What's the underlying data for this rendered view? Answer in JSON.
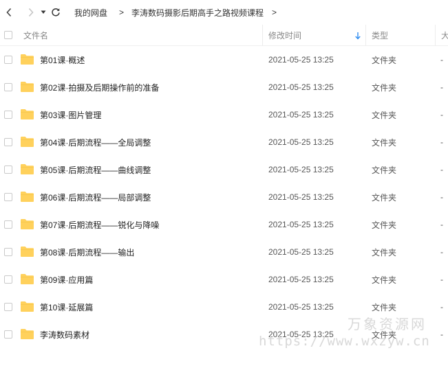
{
  "breadcrumb": {
    "root": "我的网盘",
    "separator": ">",
    "current": "李涛数码摄影后期高手之路视频课程"
  },
  "columns": {
    "name": "文件名",
    "modified": "修改时间",
    "type": "类型",
    "size": "大"
  },
  "files": [
    {
      "name": "第01课·概述",
      "modified": "2021-05-25 13:25",
      "type": "文件夹",
      "size": "-"
    },
    {
      "name": "第02课·拍摄及后期操作前的准备",
      "modified": "2021-05-25 13:25",
      "type": "文件夹",
      "size": "-"
    },
    {
      "name": "第03课·图片管理",
      "modified": "2021-05-25 13:25",
      "type": "文件夹",
      "size": "-"
    },
    {
      "name": "第04课·后期流程——全局调整",
      "modified": "2021-05-25 13:25",
      "type": "文件夹",
      "size": "-"
    },
    {
      "name": "第05课·后期流程——曲线调整",
      "modified": "2021-05-25 13:25",
      "type": "文件夹",
      "size": "-"
    },
    {
      "name": "第06课·后期流程——局部调整",
      "modified": "2021-05-25 13:25",
      "type": "文件夹",
      "size": "-"
    },
    {
      "name": "第07课·后期流程——锐化与降噪",
      "modified": "2021-05-25 13:25",
      "type": "文件夹",
      "size": "-"
    },
    {
      "name": "第08课·后期流程——输出",
      "modified": "2021-05-25 13:25",
      "type": "文件夹",
      "size": "-"
    },
    {
      "name": "第09课·应用篇",
      "modified": "2021-05-25 13:25",
      "type": "文件夹",
      "size": "-"
    },
    {
      "name": "第10课·延展篇",
      "modified": "2021-05-25 13:25",
      "type": "文件夹",
      "size": "-"
    },
    {
      "name": "李涛数码素材",
      "modified": "2021-05-25 13:25",
      "type": "文件夹",
      "size": "-"
    }
  ],
  "watermark": {
    "title": "万象资源网",
    "url": "https://www.wxzyw.cn"
  },
  "icons": {
    "back": "chevron-left-icon",
    "forward": "chevron-right-icon",
    "history": "caret-down-icon",
    "refresh": "refresh-icon",
    "sort": "arrow-down-icon",
    "folder": "folder-icon"
  },
  "colors": {
    "folder": "#ffd15c",
    "sort_arrow": "#2e8cf0"
  }
}
